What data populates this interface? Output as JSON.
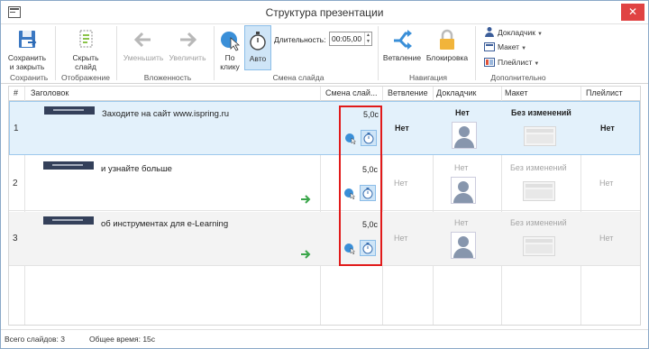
{
  "window": {
    "title": "Структура презентации",
    "close_glyph": "✕"
  },
  "ribbon": {
    "save_group": {
      "label": "Сохранить",
      "save_close": "Сохранить\nи закрыть"
    },
    "display_group": {
      "label": "Отображение",
      "hide_slide": "Скрыть\nслайд"
    },
    "nesting_group": {
      "label": "Вложенность",
      "decrease": "Уменьшить",
      "increase": "Увеличить"
    },
    "transition_group": {
      "label": "Смена слайда",
      "on_click": "По\nклику",
      "auto": "Авто",
      "duration_label": "Длительность:",
      "duration_value": "00:05,00"
    },
    "navigation_group": {
      "label": "Навигация",
      "branching": "Ветвление",
      "locking": "Блокировка"
    },
    "extra_group": {
      "label": "Дополнительно",
      "presenter": "Докладчик",
      "layout": "Макет",
      "player": "Плейлист"
    }
  },
  "table": {
    "columns": {
      "num": "#",
      "title": "Заголовок",
      "transition": "Смена слай...",
      "branching": "Ветвление",
      "presenter": "Докладчик",
      "layout": "Макет",
      "playlist": "Плейлист"
    },
    "rows": [
      {
        "num": "1",
        "title": "Заходите на сайт www.ispring.ru",
        "duration": "5,0с",
        "branching": "Нет",
        "presenter": "Нет",
        "layout": "Без изменений",
        "playlist": "Нет"
      },
      {
        "num": "2",
        "title": "и узнайте больше",
        "duration": "5,0с",
        "branching": "Нет",
        "presenter": "Нет",
        "layout": "Без изменений",
        "playlist": "Нет"
      },
      {
        "num": "3",
        "title": "об инструментах для e-Learning",
        "duration": "5,0с",
        "branching": "Нет",
        "presenter": "Нет",
        "layout": "Без изменений",
        "playlist": "Нет"
      }
    ]
  },
  "status": {
    "total_slides": "Всего слайдов: 3",
    "total_time": "Общее время: 15с"
  },
  "colors": {
    "accent": "#3a8fd8",
    "selected_row": "#e3f1fb",
    "highlight_border": "#e11a1a",
    "next_arrow": "#3aa64a",
    "lock": "#f1b43b"
  }
}
